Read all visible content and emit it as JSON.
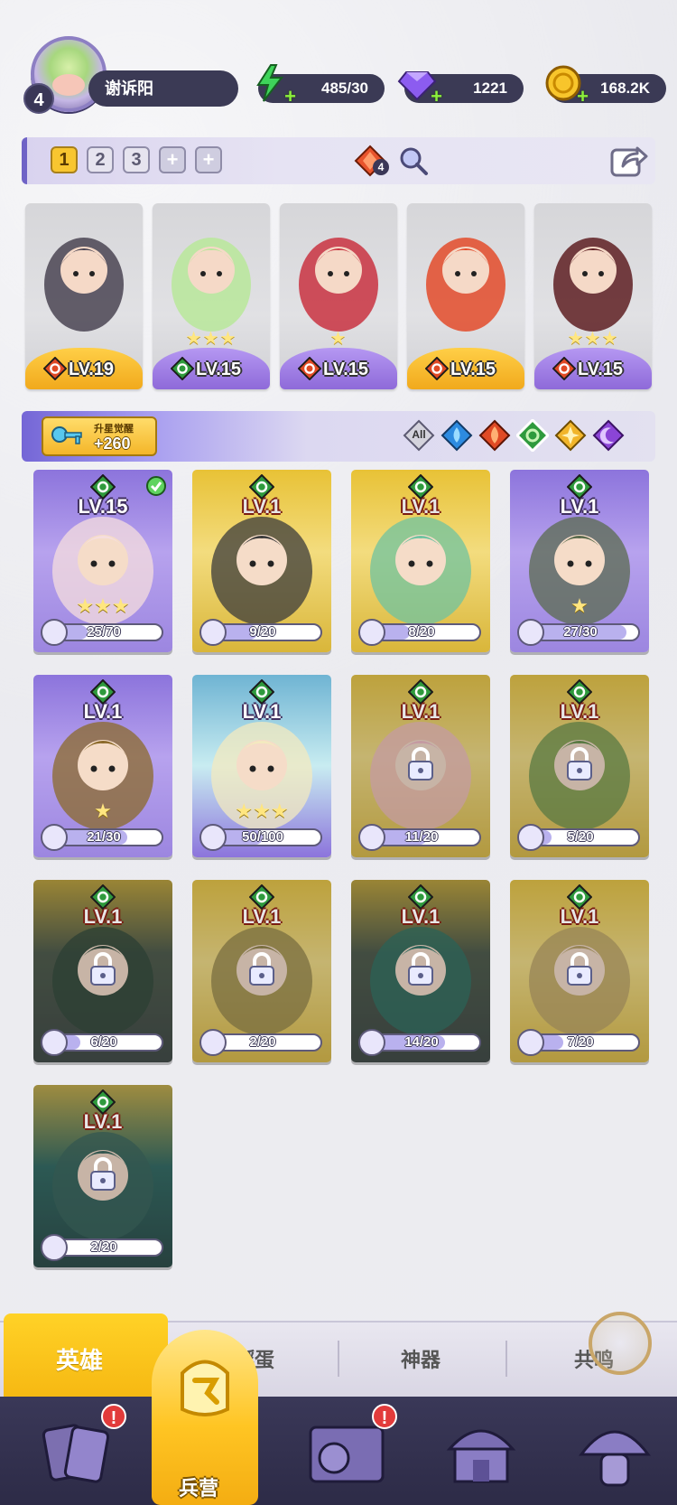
{
  "player": {
    "level": "4",
    "name": "谢诉阳"
  },
  "resources": [
    {
      "name": "energy",
      "value": "485/30",
      "icon": "lightning-icon",
      "color": "#33c24a"
    },
    {
      "name": "gems",
      "value": "1221",
      "icon": "gem-icon",
      "color": "#8c5cf0"
    },
    {
      "name": "coins",
      "value": "168.2K",
      "icon": "coin-icon",
      "color": "#f4b41b"
    }
  ],
  "team_bar": {
    "tabs": [
      "1",
      "2",
      "3",
      "+",
      "+"
    ],
    "active_tab": "1",
    "fire_count": "4"
  },
  "team": [
    {
      "level": "LV.19",
      "element": "fire",
      "stars": "",
      "frame": "gold"
    },
    {
      "level": "LV.15",
      "element": "nature",
      "stars": "★★★",
      "frame": "purple"
    },
    {
      "level": "LV.15",
      "element": "fire",
      "stars": "★",
      "frame": "purple"
    },
    {
      "level": "LV.15",
      "element": "fire",
      "stars": "",
      "frame": "gold"
    },
    {
      "level": "LV.15",
      "element": "fire",
      "stars": "★★★",
      "frame": "purple"
    }
  ],
  "filter_bar": {
    "awaken_title": "升星觉醒",
    "awaken_value": "+260",
    "filters": [
      "All",
      "water",
      "fire",
      "nature",
      "light",
      "dark"
    ],
    "all_label": "All",
    "selected": "nature"
  },
  "heroes": [
    {
      "level": "LV.15",
      "fragments": "25/70",
      "progress": 0.36,
      "stars": "★★★",
      "frame": "purple",
      "locked": false,
      "checked": true
    },
    {
      "level": "LV.1",
      "fragments": "9/20",
      "progress": 0.45,
      "stars": "",
      "frame": "gold",
      "locked": false,
      "checked": false
    },
    {
      "level": "LV.1",
      "fragments": "8/20",
      "progress": 0.4,
      "stars": "",
      "frame": "gold",
      "locked": false,
      "checked": false
    },
    {
      "level": "LV.1",
      "fragments": "27/30",
      "progress": 0.9,
      "stars": "★",
      "frame": "purple",
      "locked": false,
      "checked": false
    },
    {
      "level": "LV.1",
      "fragments": "21/30",
      "progress": 0.7,
      "stars": "★",
      "frame": "purple",
      "locked": false,
      "checked": false
    },
    {
      "level": "LV.1",
      "fragments": "50/100",
      "progress": 0.5,
      "stars": "★★★",
      "frame": "sky",
      "locked": false,
      "checked": false
    },
    {
      "level": "LV.1",
      "fragments": "11/20",
      "progress": 0.55,
      "stars": "",
      "frame": "gold",
      "locked": true,
      "checked": false
    },
    {
      "level": "LV.1",
      "fragments": "5/20",
      "progress": 0.25,
      "stars": "",
      "frame": "gold",
      "locked": true,
      "checked": false
    },
    {
      "level": "LV.1",
      "fragments": "6/20",
      "progress": 0.3,
      "stars": "",
      "frame": "dark",
      "locked": true,
      "checked": false
    },
    {
      "level": "LV.1",
      "fragments": "2/20",
      "progress": 0.1,
      "stars": "",
      "frame": "gold",
      "locked": true,
      "checked": false
    },
    {
      "level": "LV.1",
      "fragments": "14/20",
      "progress": 0.7,
      "stars": "",
      "frame": "dark",
      "locked": true,
      "checked": false
    },
    {
      "level": "LV.1",
      "fragments": "7/20",
      "progress": 0.35,
      "stars": "",
      "frame": "gold",
      "locked": true,
      "checked": false
    },
    {
      "level": "LV.1",
      "fragments": "2/20",
      "progress": 0.1,
      "stars": "",
      "frame": "dark2",
      "locked": true,
      "checked": false
    }
  ],
  "sub_tabs": [
    "英雄",
    "孵蛋",
    "神器",
    "共鸣"
  ],
  "nav": {
    "active_label": "兵营",
    "badges": [
      "!",
      "!"
    ]
  }
}
